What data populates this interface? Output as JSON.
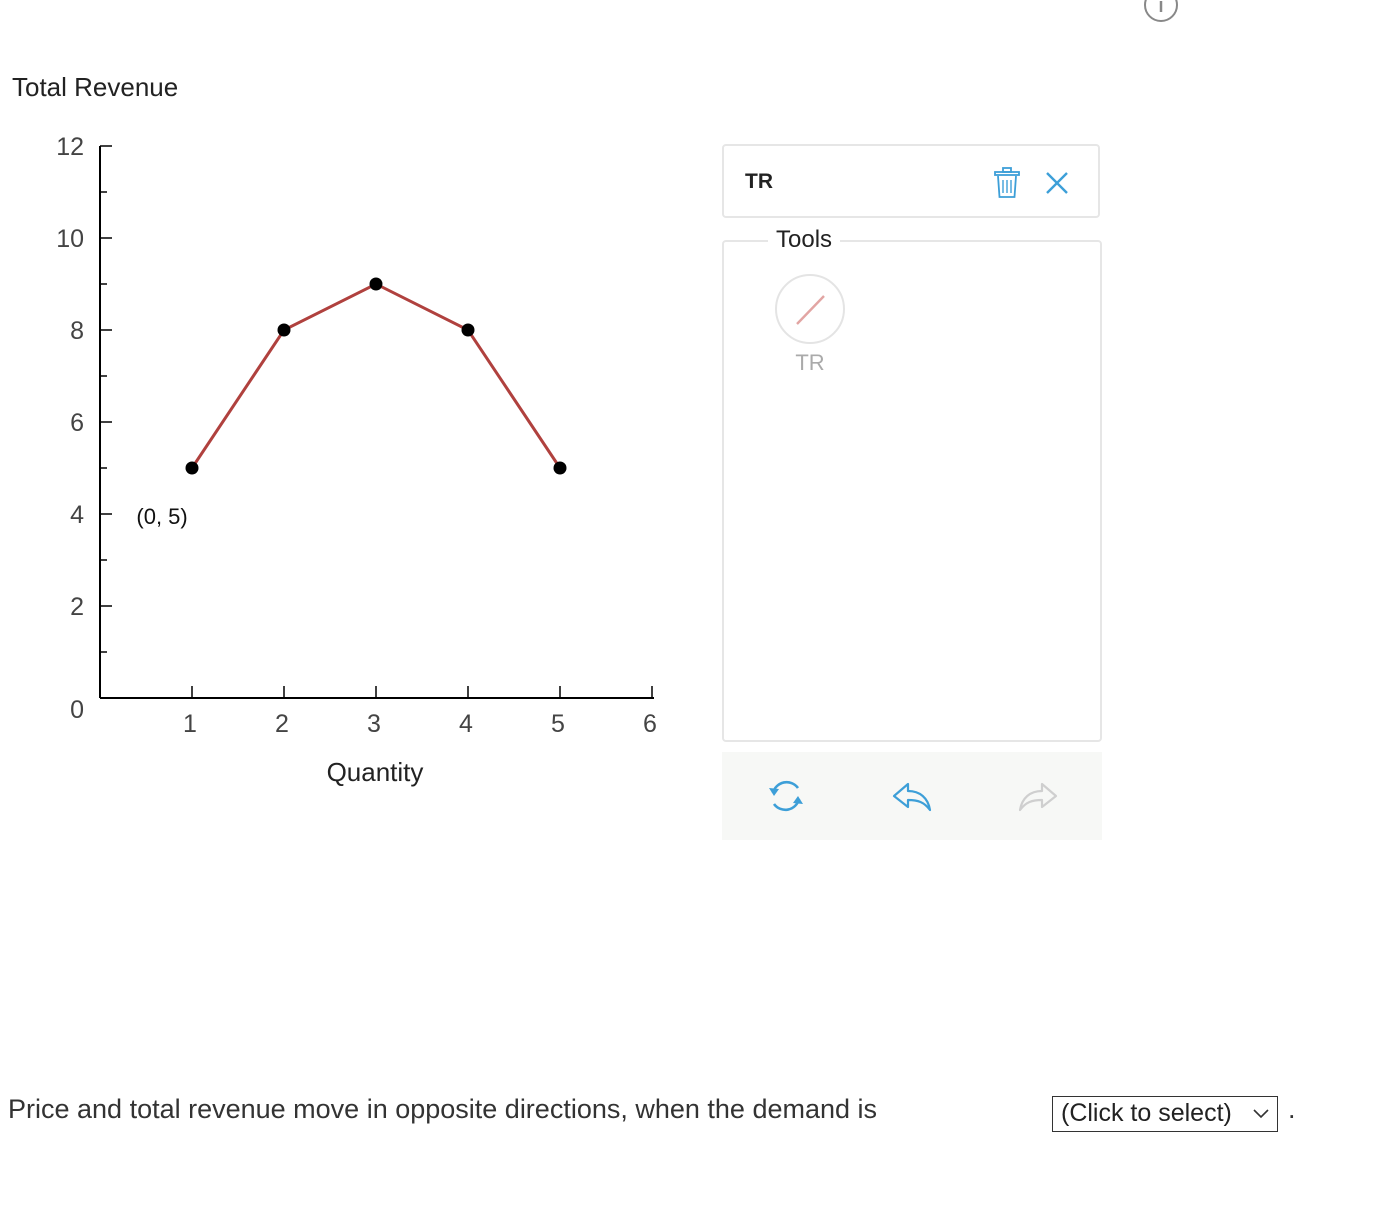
{
  "chart_data": {
    "type": "line",
    "title": "Total Revenue",
    "xlabel": "Quantity",
    "ylabel": "Total Revenue",
    "xlim": [
      0,
      6
    ],
    "ylim": [
      0,
      12
    ],
    "x_ticks": [
      "1",
      "2",
      "3",
      "4",
      "5",
      "6"
    ],
    "y_ticks": [
      "0",
      "2",
      "4",
      "6",
      "8",
      "10",
      "12"
    ],
    "grid": false,
    "series": [
      {
        "name": "TR",
        "color": "#b0413e",
        "points": [
          [
            1,
            5
          ],
          [
            2,
            8
          ],
          [
            3,
            9
          ],
          [
            4,
            8
          ],
          [
            5,
            5
          ]
        ]
      }
    ],
    "annotations": [
      {
        "text": "(0, 5)",
        "x": 0.7,
        "y": 4
      }
    ]
  },
  "curve_panel": {
    "selected_curve": "TR",
    "delete_icon": "trash-icon",
    "close_icon": "close-icon"
  },
  "tools": {
    "legend": "Tools",
    "items": [
      {
        "label": "TR",
        "icon": "line-tool-icon",
        "color": "#e2a5a3"
      }
    ]
  },
  "actions": {
    "reset_icon": "reset-icon",
    "undo_icon": "undo-icon",
    "redo_icon": "redo-icon",
    "accent_color": "#3d9fd8"
  },
  "question": {
    "text": "Price and total revenue move in opposite directions, when the demand is",
    "select_value": "(Click to select)",
    "end": "."
  }
}
